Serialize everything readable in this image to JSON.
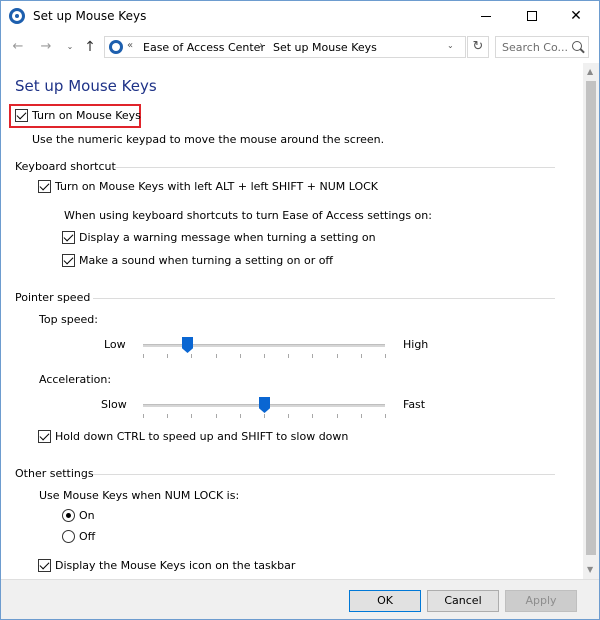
{
  "window": {
    "title": "Set up Mouse Keys",
    "controls": {
      "minimize": "minimize",
      "maximize": "maximize",
      "close": "✕"
    }
  },
  "nav": {
    "back": "←",
    "forward": "→",
    "recent": "⌄",
    "up": "↑",
    "address_chevron": "«",
    "crumbs": [
      "Ease of Access Center",
      "Set up Mouse Keys"
    ],
    "crumb_separator": "›",
    "dropdown": "⌄",
    "refresh": "↻",
    "search_placeholder": "Search Co..."
  },
  "page": {
    "title": "Set up Mouse Keys",
    "turn_on": {
      "label": "Turn on Mouse Keys",
      "checked": true
    },
    "turn_on_desc": "Use the numeric keypad to move the mouse around the screen.",
    "keyboard_shortcut": {
      "heading": "Keyboard shortcut",
      "shortcut": {
        "label": "Turn on Mouse Keys with left ALT + left SHIFT + NUM LOCK",
        "checked": true
      },
      "intro": "When using keyboard shortcuts to turn Ease of Access settings on:",
      "warning": {
        "label": "Display a warning message when turning a setting on",
        "checked": true
      },
      "sound": {
        "label": "Make a sound when turning a setting on or off",
        "checked": true
      }
    },
    "pointer_speed": {
      "heading": "Pointer speed",
      "top_speed": {
        "label": "Top speed:",
        "low": "Low",
        "high": "High",
        "value": 0.18
      },
      "acceleration": {
        "label": "Acceleration:",
        "low": "Slow",
        "high": "Fast",
        "value": 0.5
      },
      "ctrl_shift": {
        "label": "Hold down CTRL to speed up and SHIFT to slow down",
        "checked": true
      }
    },
    "other_settings": {
      "heading": "Other settings",
      "numlock_label": "Use Mouse Keys when NUM LOCK is:",
      "on": {
        "label": "On",
        "checked": true
      },
      "off": {
        "label": "Off",
        "checked": false
      },
      "taskbar_icon": {
        "label": "Display the Mouse Keys icon on the taskbar",
        "checked": true
      }
    }
  },
  "footer": {
    "ok": "OK",
    "cancel": "Cancel",
    "apply": "Apply"
  },
  "colors": {
    "title_blue": "#1e3287",
    "highlight_red": "#e0242b",
    "slider_thumb": "#0a66d2"
  }
}
